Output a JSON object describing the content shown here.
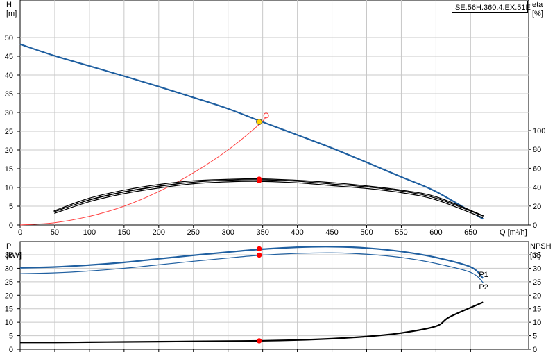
{
  "model_label": "SE.56H.360.4.EX.51E",
  "chart_data": [
    {
      "type": "line",
      "id": "head_eta",
      "xlabel": "Q [m³/h]",
      "ylabel": "H\n[m]",
      "y2label": "eta\n[%]",
      "xlim": [
        0,
        700
      ],
      "ylim": [
        0,
        55
      ],
      "y2lim": [
        0,
        150
      ],
      "grid": true,
      "xticks": [
        0,
        50,
        100,
        150,
        200,
        250,
        300,
        350,
        400,
        450,
        500,
        550,
        600,
        650
      ],
      "yticks": [
        0,
        5,
        10,
        15,
        20,
        25,
        30,
        35,
        40,
        45,
        50
      ],
      "y2ticks": [
        0,
        20,
        40,
        60,
        80,
        100
      ],
      "series": [
        {
          "key": "head",
          "color": "#1f5fa0",
          "width": 2.2,
          "axis": "y",
          "x": [
            0,
            50,
            100,
            150,
            200,
            250,
            300,
            345,
            400,
            450,
            500,
            550,
            600,
            668
          ],
          "y": [
            48.2,
            45.1,
            42.4,
            39.7,
            36.9,
            34.0,
            31.0,
            27.8,
            24.0,
            20.5,
            16.7,
            12.8,
            8.9,
            1.6
          ]
        },
        {
          "key": "system",
          "color": "#ff4040",
          "width": 1,
          "axis": "y",
          "x": [
            0,
            50,
            100,
            150,
            200,
            250,
            300,
            345,
            355
          ],
          "y": [
            0,
            0.6,
            2.3,
            5.0,
            8.9,
            13.9,
            20.0,
            26.8,
            28.9
          ]
        },
        {
          "key": "eta1",
          "color": "#000000",
          "width": 2.2,
          "axis": "y2",
          "x": [
            49,
            100,
            150,
            200,
            250,
            300,
            345,
            400,
            450,
            500,
            550,
            600,
            668
          ],
          "y": [
            14,
            27.5,
            36,
            42,
            46,
            47.5,
            48,
            46.5,
            44,
            40.5,
            36,
            29,
            9
          ]
        },
        {
          "key": "eta2",
          "color": "#000000",
          "width": 2.2,
          "axis": "y2",
          "x": [
            49,
            100,
            150,
            200,
            250,
            300,
            345,
            400,
            450,
            500,
            550,
            600,
            668
          ],
          "y": [
            13,
            25.5,
            34,
            40,
            44.5,
            46.5,
            47,
            45.5,
            42.5,
            39.5,
            35,
            27.5,
            8.5
          ]
        }
      ],
      "points": [
        {
          "x": 345,
          "y": 27.5,
          "axis": "y",
          "fill": "#ffd200",
          "stroke": "#444444",
          "r": 4
        },
        {
          "x": 355,
          "y": 29.2,
          "axis": "y",
          "fill": "none",
          "stroke": "#ff4040",
          "r": 3.5
        },
        {
          "x": 345,
          "y": 48.5,
          "axis": "y2",
          "fill": "#ff0000",
          "stroke": "#ff0000",
          "r": 3.2
        },
        {
          "x": 345,
          "y": 47,
          "axis": "y2",
          "fill": "#ff0000",
          "stroke": "#ff0000",
          "r": 3.2
        }
      ]
    },
    {
      "type": "line",
      "id": "power_npsh",
      "xlabel": "",
      "ylabel": "P\n[kW]",
      "y2label": "NPSH\n[m]",
      "xlim": [
        0,
        700
      ],
      "ylim": [
        0,
        40
      ],
      "y2lim": [
        0,
        40
      ],
      "grid": true,
      "yticks": [
        0,
        5,
        10,
        15,
        20,
        25,
        30,
        35
      ],
      "y2ticks": [
        0,
        5,
        10,
        15,
        20,
        25,
        30,
        35
      ],
      "series": [
        {
          "key": "P1",
          "name": "P1",
          "color": "#1f5fa0",
          "width": 2.2,
          "axis": "y",
          "x": [
            0,
            50,
            100,
            150,
            200,
            250,
            300,
            345,
            400,
            450,
            500,
            550,
            600,
            650,
            668
          ],
          "y": [
            30.2,
            30.5,
            31.2,
            32.2,
            33.5,
            34.8,
            36.0,
            37.0,
            37.8,
            38.0,
            37.5,
            36.2,
            34.0,
            30.5,
            26.3
          ]
        },
        {
          "key": "P2",
          "name": "P2",
          "color": "#1f5fa0",
          "width": 1.2,
          "axis": "y",
          "x": [
            0,
            50,
            100,
            150,
            200,
            250,
            300,
            345,
            400,
            450,
            500,
            550,
            600,
            650,
            668
          ],
          "y": [
            28.0,
            28.3,
            29.0,
            30.0,
            31.3,
            32.6,
            33.8,
            34.8,
            35.5,
            35.7,
            35.2,
            34.0,
            31.8,
            28.5,
            24.7
          ]
        },
        {
          "key": "NPSH",
          "color": "#000000",
          "width": 2.2,
          "axis": "y2",
          "x": [
            0,
            50,
            100,
            150,
            200,
            250,
            300,
            345,
            400,
            450,
            500,
            550,
            600,
            620,
            668
          ],
          "y": [
            2.5,
            2.5,
            2.6,
            2.7,
            2.8,
            2.9,
            3.0,
            3.1,
            3.4,
            3.9,
            4.7,
            6.0,
            8.5,
            12.0,
            17.4
          ]
        }
      ],
      "points": [
        {
          "x": 345,
          "y": 37.2,
          "axis": "y",
          "fill": "#ff0000",
          "stroke": "#ff0000",
          "r": 3.2
        },
        {
          "x": 345,
          "y": 34.9,
          "axis": "y",
          "fill": "#ff0000",
          "stroke": "#ff0000",
          "r": 3.2
        },
        {
          "x": 345,
          "y": 3.1,
          "axis": "y2",
          "fill": "#ff0000",
          "stroke": "#ff0000",
          "r": 3.2
        }
      ]
    }
  ]
}
